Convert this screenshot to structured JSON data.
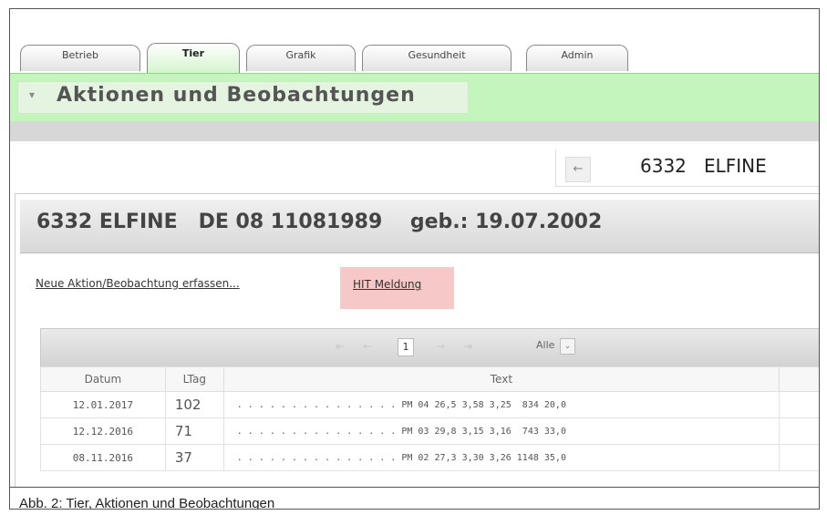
{
  "tabs": [
    {
      "label": "Betrieb",
      "active": false
    },
    {
      "label": "Tier",
      "active": true
    },
    {
      "label": "Grafik",
      "active": false
    },
    {
      "label": "Gesundheit",
      "active": false
    },
    {
      "label": "Admin",
      "active": false
    }
  ],
  "section": {
    "arrow": "▾",
    "title": "Aktionen und Beobachtungen"
  },
  "nav": {
    "prev": "←",
    "animal": "6332   ELFINE"
  },
  "animal_header": {
    "title": "6332 ELFINE   DE 08 11081989    geb.: 19.07.2002"
  },
  "links": {
    "new_action": "Neue Aktion/Beobachtung erfassen...",
    "hit": "HIT Meldung"
  },
  "pager": {
    "first": "⇤",
    "prev": "←",
    "page": "1",
    "next": "→",
    "last": "⇥",
    "page_size": "Alle",
    "dropdown": "⌄"
  },
  "table": {
    "headers": [
      "Datum",
      "LTag",
      "Text"
    ],
    "rows": [
      {
        "datum": "12.01.2017",
        "ltag": "102",
        "text": ". . . . . . . . . . . . . . . PM 04 26,5 3,58 3,25  834 20,0"
      },
      {
        "datum": "12.12.2016",
        "ltag": "71",
        "text": ". . . . . . . . . . . . . . . PM 03 29,8 3,15 3,16  743 33,0"
      },
      {
        "datum": "08.11.2016",
        "ltag": "37",
        "text": ". . . . . . . . . . . . . . . PM 02 27,3 3,30 3,26 1148 35,0"
      }
    ]
  },
  "caption": "Abb. 2: Tier, Aktionen und Beobachtungen"
}
